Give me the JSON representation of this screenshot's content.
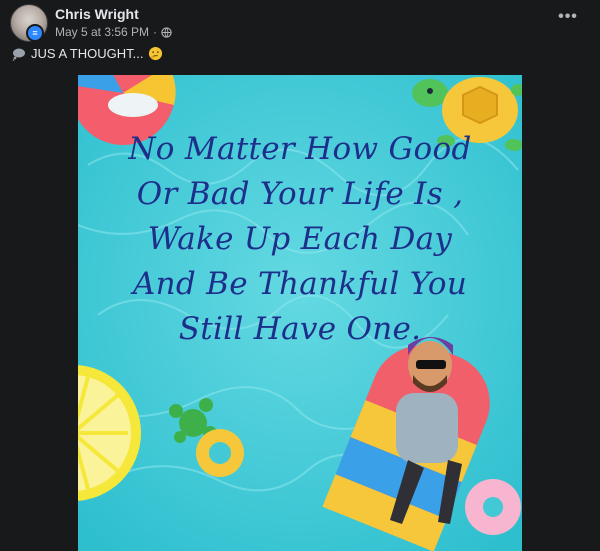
{
  "post": {
    "author": "Chris Wright",
    "timestamp": "May 5 at 3:56 PM",
    "separator": "·",
    "privacy_icon": "globe-icon",
    "more_label": "•••",
    "caption": "JUS A THOUGHT...",
    "caption_icon": "thought-bubble-icon",
    "caption_emoji": "thinking-face-icon"
  },
  "image": {
    "quote_lines": [
      "No Matter How Good",
      "Or Bad Your Life Is ,",
      "Wake Up Each Day",
      "And Be Thankful You",
      "Still Have One."
    ],
    "background_color": "#3fcad6",
    "text_color": "#1d2f8a"
  }
}
